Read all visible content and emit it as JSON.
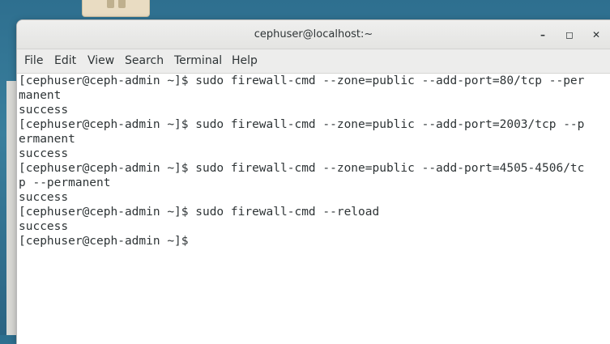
{
  "window": {
    "title": "cephuser@localhost:~",
    "minimize_label": "–",
    "maximize_label": "◻",
    "close_label": "✕"
  },
  "menu": {
    "items": [
      "File",
      "Edit",
      "View",
      "Search",
      "Terminal",
      "Help"
    ]
  },
  "terminal": {
    "lines": [
      "[cephuser@ceph-admin ~]$ sudo firewall-cmd --zone=public --add-port=80/tcp --per",
      "manent",
      "success",
      "[cephuser@ceph-admin ~]$ sudo firewall-cmd --zone=public --add-port=2003/tcp --p",
      "ermanent",
      "success",
      "[cephuser@ceph-admin ~]$ sudo firewall-cmd --zone=public --add-port=4505-4506/tc",
      "p --permanent",
      "success",
      "[cephuser@ceph-admin ~]$ sudo firewall-cmd --reload",
      "success",
      "[cephuser@ceph-admin ~]$ "
    ]
  },
  "icons": {
    "desktop": "folder-icon",
    "minimize": "minimize-icon",
    "maximize": "maximize-icon",
    "close": "close-icon"
  },
  "colors": {
    "desktop_bg": "#2e6f8f",
    "titlebar_bg": "#e4e4e2",
    "terminal_bg": "#ffffff",
    "terminal_fg": "#2e3436"
  }
}
